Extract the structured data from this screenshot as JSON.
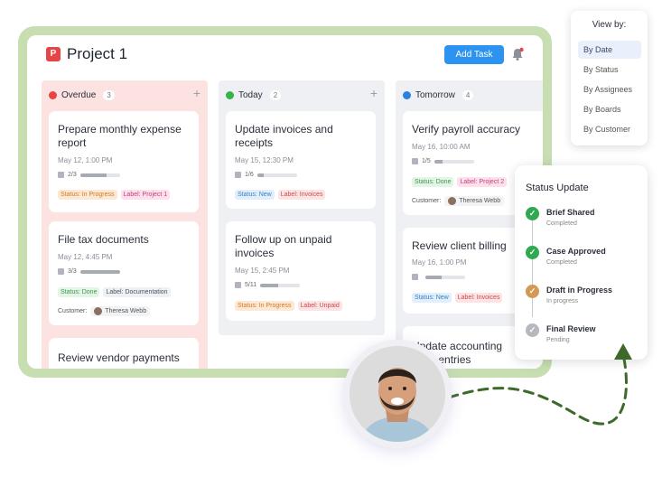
{
  "app": {
    "logo_letter": "P",
    "title": "Project 1",
    "add_task_label": "Add Task"
  },
  "columns": [
    {
      "name": "Overdue",
      "count": "3",
      "color": "#e64545",
      "cards": [
        {
          "title": "Prepare monthly expense report",
          "date": "May 12, 1:00 PM",
          "progress": "2/3",
          "progress_fraction": 0.67,
          "tags": [
            "Status: In Progress",
            "Label: Project 1"
          ]
        },
        {
          "title": "File tax documents",
          "date": "May 12, 4:45 PM",
          "progress": "3/3",
          "progress_fraction": 1.0,
          "tags": [
            "Status: Done",
            "Label: Documentation"
          ],
          "customer_label": "Customer:",
          "customer": "Theresa Webb"
        },
        {
          "title": "Review vendor payments"
        }
      ]
    },
    {
      "name": "Today",
      "count": "2",
      "color": "#36b34a",
      "cards": [
        {
          "title": "Update invoices and receipts",
          "date": "May 15, 12:30 PM",
          "progress": "1/6",
          "progress_fraction": 0.17,
          "tags": [
            "Status: New",
            "Label: Invoices"
          ]
        },
        {
          "title": "Follow up on unpaid invoices",
          "date": "May 15, 2:45 PM",
          "progress": "5/11",
          "progress_fraction": 0.45,
          "tags": [
            "Status: In Progress",
            "Label: Unpaid"
          ]
        }
      ]
    },
    {
      "name": "Tomorrow",
      "count": "4",
      "color": "#2d7fe0",
      "cards": [
        {
          "title": "Verify payroll accuracy",
          "date": "May 16, 10:00 AM",
          "progress": "1/5",
          "progress_fraction": 0.2,
          "tags": [
            "Status: Done",
            "Label: Project 2"
          ],
          "customer_label": "Customer:",
          "customer": "Theresa Webb"
        },
        {
          "title": "Review client billing",
          "date": "May 16, 1:00 PM",
          "progress": "",
          "progress_fraction": 0.4,
          "tags": [
            "Status: New",
            "Label: Invoices"
          ]
        },
        {
          "title_line1": "Update accounting",
          "title_line2": "ware entries"
        }
      ]
    }
  ],
  "view_by": {
    "title": "View by:",
    "options": [
      "By Date",
      "By Status",
      "By Assignees",
      "By Boards",
      "By Customer"
    ],
    "selected": "By Date"
  },
  "status_update": {
    "title": "Status Update",
    "steps": [
      {
        "name": "Brief Shared",
        "state": "Completed",
        "color": "#2fa84f"
      },
      {
        "name": "Case Approved",
        "state": "Completed",
        "color": "#2fa84f"
      },
      {
        "name": "Draft in Progress",
        "state": "In progress",
        "color": "#d49a55"
      },
      {
        "name": "Final Review",
        "state": "Pending",
        "color": "#b5b8bd"
      }
    ]
  },
  "colors": {
    "frame": "#c6deb0",
    "accent": "#2d93f0",
    "arrow": "#3d6a2a"
  }
}
